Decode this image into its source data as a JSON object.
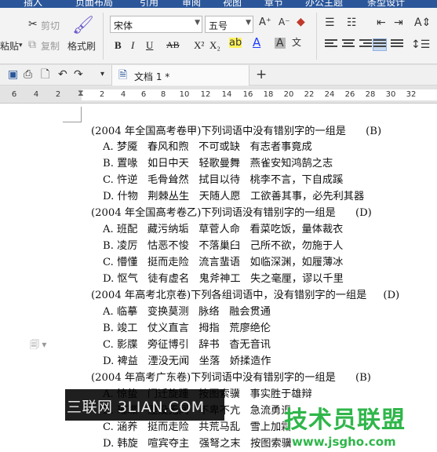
{
  "ribbon_tabs": [
    "插入",
    "页面布局",
    "引用",
    "审阅",
    "视图",
    "章节",
    "办公主题",
    "条型设计"
  ],
  "clipboard": {
    "cut": "剪切",
    "copy": "复制",
    "paste": "粘贴",
    "format_painter": "格式刷"
  },
  "font": {
    "name": "宋体",
    "size": "五号"
  },
  "format_buttons": [
    "B",
    "I",
    "U",
    "AB",
    "X²",
    "X₂"
  ],
  "doc_tab": {
    "name": "文档 1 *",
    "add": "+"
  },
  "ruler_ticks": [
    "6",
    "4",
    "2",
    "2",
    "4",
    "6",
    "8",
    "10",
    "12",
    "14",
    "16",
    "18",
    "20",
    "22",
    "24",
    "26",
    "28",
    "30",
    "32"
  ],
  "lines": [
    "(2004 年全国高考卷甲)下列词语中没有错别字的一组是      (B)",
    "A. 梦魇   春风和煦   不可或缺   有志者事竟成",
    "B. 置喙   如日中天   轻歌曼舞   燕雀安知鸿鹄之志",
    "C. 忤逆   毛骨耸然   拭目以待   桃李不言，下自成蹊",
    "D. 什物   荆棘丛生   天随人愿   工欲善其事，必先利其器",
    "(2004 年全国高考卷乙)下列词语没有错别字的一组是      (D)",
    "A. 班配   藏污纳垢   草菅人命   看菜吃饭，量体裁衣",
    "B. 凌厉   怙恶不悛   不落巢臼   己所不欲，勿施于人",
    "C. 懵懂   挺而走险   流言蜚语   如临深渊，如履薄冰",
    "D. 怄气   徒有虚名   鬼斧神工   失之毫厘，谬以千里",
    "(2004 年高考北京卷)下列各组词语中，没有错别字的一组是     (D)",
    "A. 临摹   变换莫测   脉络   融会贯通",
    "B. 竣工   仗义直言   拇指   荒廖绝伦",
    "C. 影牒   旁征博引   辞书   杳无音讯",
    "D. 裨益   湮没无闻   坐落   娇揉造作",
    "(2004 年高考广东卷)下列词语中没有错别字的一组是      (B)",
    "A. 惊蛰   门迁旋踵   按图索骥   事实胜于雄辩",
    "B. 璀璨   湮没无闻   不卑不亢   急流勇退",
    "C. 涵养   挺而走险   共荒马乱   雪上加霜",
    "D. 韩旋   喧宾夺主   强弩之末   按图索骥"
  ],
  "watermark_left": "三联网 3LIAN.COM",
  "watermark_right": {
    "title": "技术员联盟",
    "url": "www.jsgho.com"
  }
}
